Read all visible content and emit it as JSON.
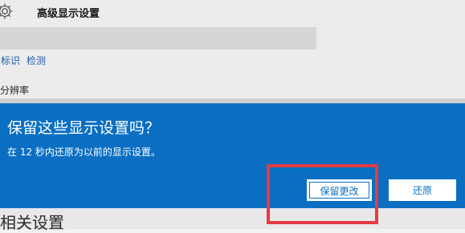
{
  "window": {
    "title": "高级显示设置",
    "icon": "gear-icon"
  },
  "display": {
    "identify_link": "标识",
    "detect_link": "检测",
    "resolution_label": "分辨率"
  },
  "dialog": {
    "title": "保留这些显示设置吗？",
    "message": "在 12 秒内还原为以前的显示设置。",
    "keep_button": "保留更改",
    "revert_button": "还原",
    "background_color": "#0a6fc2"
  },
  "background": {
    "related_heading": "相关设置"
  },
  "annotation": {
    "highlight_color": "#e53a43"
  }
}
